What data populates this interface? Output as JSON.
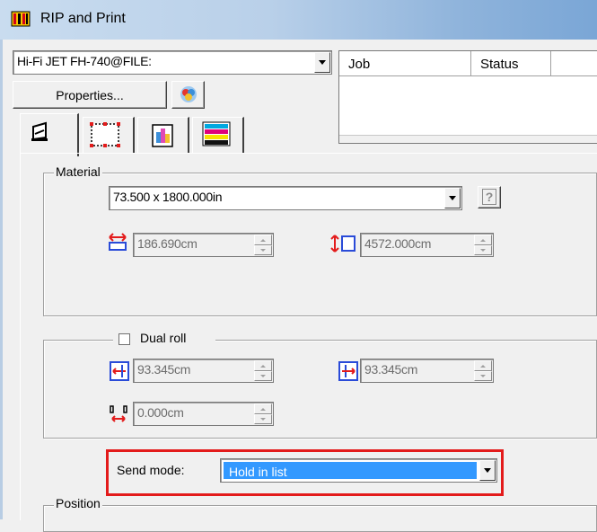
{
  "window": {
    "title": "RIP and Print"
  },
  "printer": {
    "selected": "Hi-Fi JET FH-740@FILE:"
  },
  "toolbar": {
    "properties_label": "Properties..."
  },
  "job_list": {
    "columns": [
      "Job",
      "Status"
    ]
  },
  "tabs": [
    {
      "icon": "layout-icon",
      "active": true
    },
    {
      "icon": "crop-frame-icon",
      "active": false
    },
    {
      "icon": "color-icon",
      "active": false
    },
    {
      "icon": "color-bars-icon",
      "active": false
    }
  ],
  "material": {
    "group_label": "Material",
    "size": "73.500 x 1800.000in",
    "width": "186.690cm",
    "length": "4572.000cm",
    "help_label": "?"
  },
  "dual_roll": {
    "label": "Dual roll",
    "checked": false,
    "left_width": "93.345cm",
    "right_width": "93.345cm",
    "gap": "0.000cm"
  },
  "send_mode": {
    "label": "Send mode:",
    "value": "Hold in list"
  },
  "position": {
    "group_label": "Position"
  },
  "colors": {
    "highlight": "#e31b1b",
    "selection": "#3399ff"
  }
}
